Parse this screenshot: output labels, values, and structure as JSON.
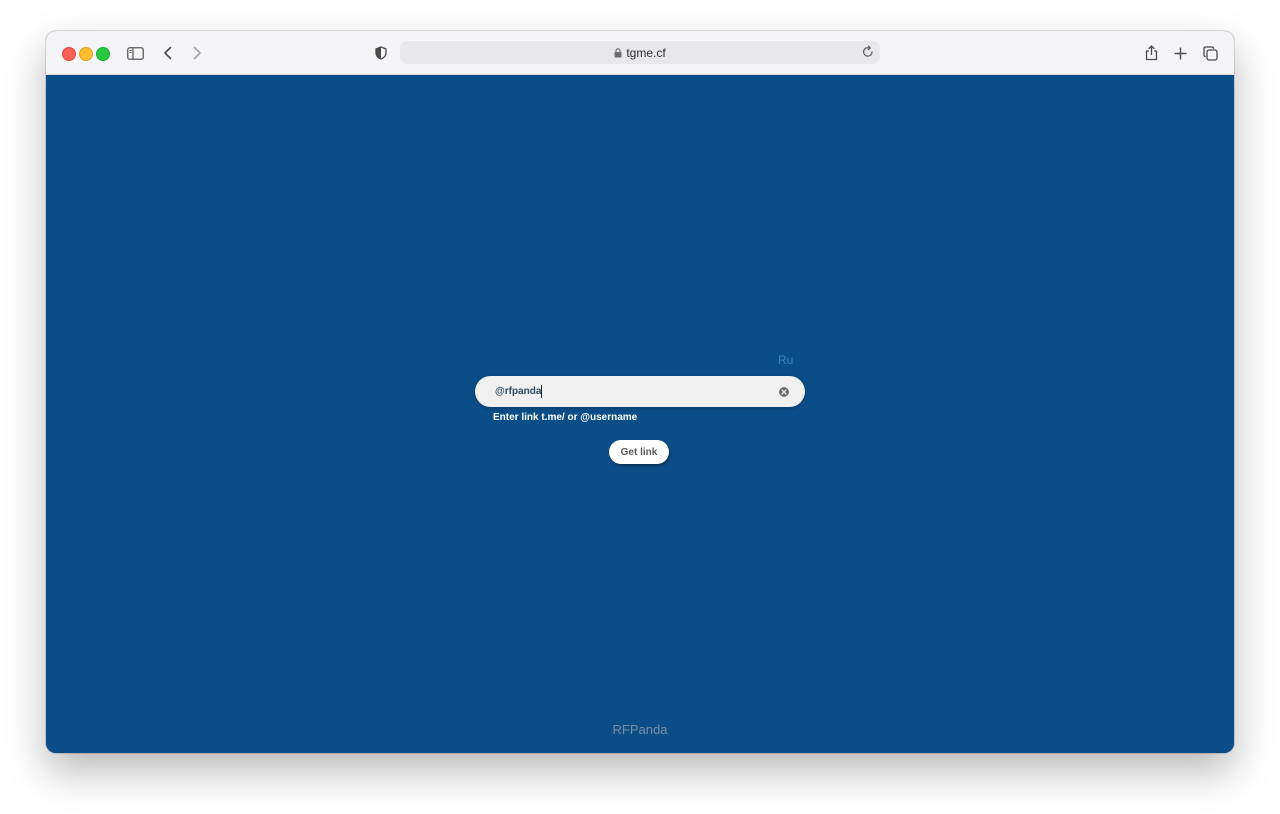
{
  "browser": {
    "url": "tgme.cf"
  },
  "page": {
    "language_link": "Ru",
    "input": {
      "value": "@rfpanda",
      "placeholder": ""
    },
    "hint": "Enter link t.me/ or @username",
    "button_label": "Get link",
    "footer": "RFPanda"
  },
  "colors": {
    "page_background": "#0b4d87",
    "language_link": "#3b7fc6",
    "footer_text": "#7d8ea3"
  }
}
